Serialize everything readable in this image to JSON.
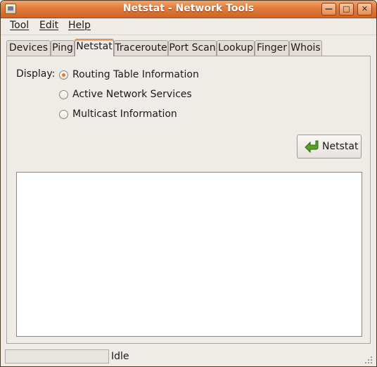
{
  "window": {
    "title": "Netstat - Network Tools",
    "controls": [
      "minimize",
      "maximize",
      "close"
    ]
  },
  "menubar": {
    "items": [
      {
        "label": "Tool"
      },
      {
        "label": "Edit"
      },
      {
        "label": "Help"
      }
    ]
  },
  "tabs": [
    {
      "label": "Devices",
      "active": false
    },
    {
      "label": "Ping",
      "active": false
    },
    {
      "label": "Netstat",
      "active": true
    },
    {
      "label": "Traceroute",
      "active": false
    },
    {
      "label": "Port Scan",
      "active": false
    },
    {
      "label": "Lookup",
      "active": false
    },
    {
      "label": "Finger",
      "active": false
    },
    {
      "label": "Whois",
      "active": false
    }
  ],
  "netstat": {
    "display_label": "Display:",
    "options": [
      {
        "label": "Routing Table Information",
        "checked": true
      },
      {
        "label": "Active Network Services",
        "checked": false
      },
      {
        "label": "Multicast Information",
        "checked": false
      }
    ],
    "button_label": "Netstat",
    "button_icon": "green-return-arrow-icon",
    "output_text": ""
  },
  "statusbar": {
    "status": "Idle",
    "progress": 0
  },
  "colors": {
    "titlebar": "#e07a3a",
    "window_bg": "#efebe7",
    "radio_selected": "#e07a3a",
    "button_icon": "#5a9e2c"
  }
}
